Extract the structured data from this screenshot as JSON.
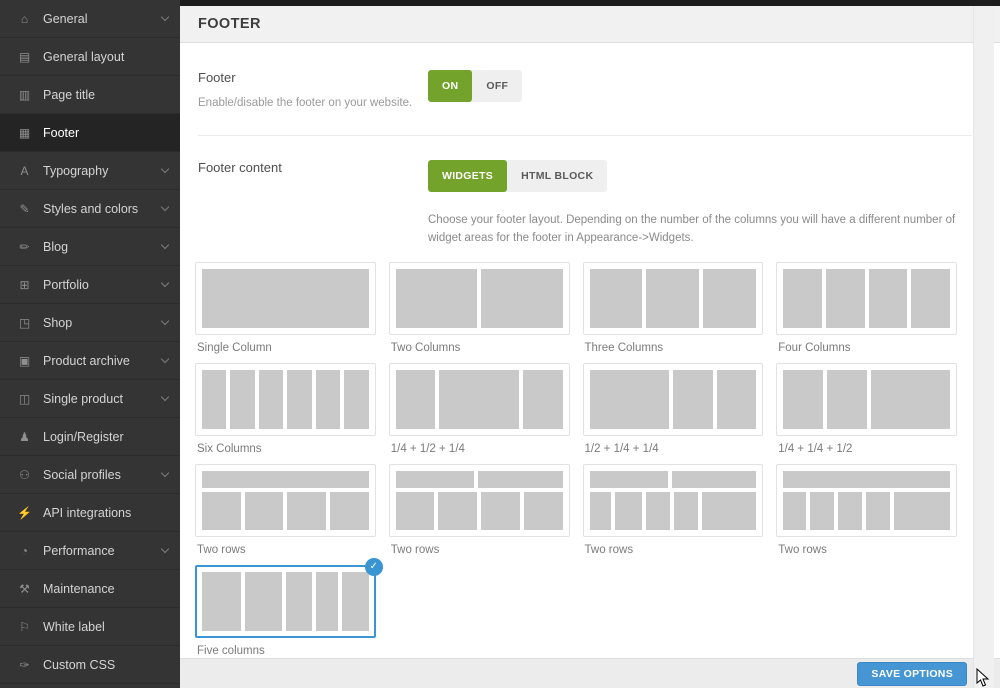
{
  "header": {
    "title": "FOOTER"
  },
  "sidebar": {
    "items": [
      {
        "label": "General",
        "icon": "home-icon",
        "expandable": true,
        "active": false
      },
      {
        "label": "General layout",
        "icon": "layout-icon",
        "expandable": false,
        "active": false
      },
      {
        "label": "Page title",
        "icon": "page-title-icon",
        "expandable": false,
        "active": false
      },
      {
        "label": "Footer",
        "icon": "footer-icon",
        "expandable": false,
        "active": true
      },
      {
        "label": "Typography",
        "icon": "typography-icon",
        "expandable": true,
        "active": false
      },
      {
        "label": "Styles and colors",
        "icon": "styles-icon",
        "expandable": true,
        "active": false
      },
      {
        "label": "Blog",
        "icon": "blog-icon",
        "expandable": true,
        "active": false
      },
      {
        "label": "Portfolio",
        "icon": "portfolio-icon",
        "expandable": true,
        "active": false
      },
      {
        "label": "Shop",
        "icon": "shop-icon",
        "expandable": true,
        "active": false
      },
      {
        "label": "Product archive",
        "icon": "archive-icon",
        "expandable": true,
        "active": false
      },
      {
        "label": "Single product",
        "icon": "product-icon",
        "expandable": true,
        "active": false
      },
      {
        "label": "Login/Register",
        "icon": "user-icon",
        "expandable": false,
        "active": false
      },
      {
        "label": "Social profiles",
        "icon": "social-icon",
        "expandable": true,
        "active": false
      },
      {
        "label": "API integrations",
        "icon": "api-icon",
        "expandable": false,
        "active": false
      },
      {
        "label": "Performance",
        "icon": "performance-icon",
        "expandable": true,
        "active": false
      },
      {
        "label": "Maintenance",
        "icon": "maintenance-icon",
        "expandable": false,
        "active": false
      },
      {
        "label": "White label",
        "icon": "tag-icon",
        "expandable": false,
        "active": false
      },
      {
        "label": "Custom CSS",
        "icon": "css-icon",
        "expandable": false,
        "active": false
      }
    ]
  },
  "settings": {
    "footer_toggle": {
      "label": "Footer",
      "description": "Enable/disable the footer on your website.",
      "on_label": "ON",
      "off_label": "OFF",
      "state": "ON"
    },
    "footer_content": {
      "label": "Footer content",
      "widgets_label": "WIDGETS",
      "html_block_label": "HTML BLOCK",
      "selected": "WIDGETS",
      "description": "Choose your footer layout. Depending on the number of the columns you will have a different number of widget areas for the footer in Appearance->Widgets."
    }
  },
  "layouts": [
    {
      "label": "Single Column",
      "rows": [
        [
          100
        ]
      ]
    },
    {
      "label": "Two Columns",
      "rows": [
        [
          50,
          50
        ]
      ]
    },
    {
      "label": "Three Columns",
      "rows": [
        [
          33,
          33,
          33
        ]
      ]
    },
    {
      "label": "Four Columns",
      "rows": [
        [
          25,
          25,
          25,
          25
        ]
      ]
    },
    {
      "label": "Six Columns",
      "rows": [
        [
          16,
          16,
          16,
          16,
          16,
          16
        ]
      ]
    },
    {
      "label": "1/4 + 1/2 + 1/4",
      "rows": [
        [
          25,
          50,
          25
        ]
      ]
    },
    {
      "label": "1/2 + 1/4 + 1/4",
      "rows": [
        [
          50,
          25,
          25
        ]
      ]
    },
    {
      "label": "1/4 + 1/4 + 1/2",
      "rows": [
        [
          25,
          25,
          50
        ]
      ]
    },
    {
      "label": "Two rows",
      "rows": [
        [
          100
        ],
        [
          25,
          25,
          25,
          25
        ]
      ]
    },
    {
      "label": "Two rows",
      "rows": [
        [
          48,
          52
        ],
        [
          25,
          25,
          25,
          25
        ]
      ]
    },
    {
      "label": "Two rows",
      "rows": [
        [
          48,
          52
        ],
        [
          14,
          18,
          16,
          16,
          36
        ]
      ]
    },
    {
      "label": "Two rows",
      "rows": [
        [
          100
        ],
        [
          15,
          16,
          16,
          16,
          37
        ]
      ]
    },
    {
      "label": "Five columns",
      "rows": [
        [
          26,
          25,
          17,
          15,
          18
        ]
      ],
      "selected": true
    }
  ],
  "save_bar": {
    "save_label": "SAVE OPTIONS"
  },
  "icons": {
    "selected_check": "✓"
  },
  "colors": {
    "accent_green": "#74a32b",
    "accent_blue": "#4696d3",
    "selected_border": "#3a96d3",
    "sidebar_bg": "#343434",
    "sidebar_active_bg": "#242424"
  }
}
